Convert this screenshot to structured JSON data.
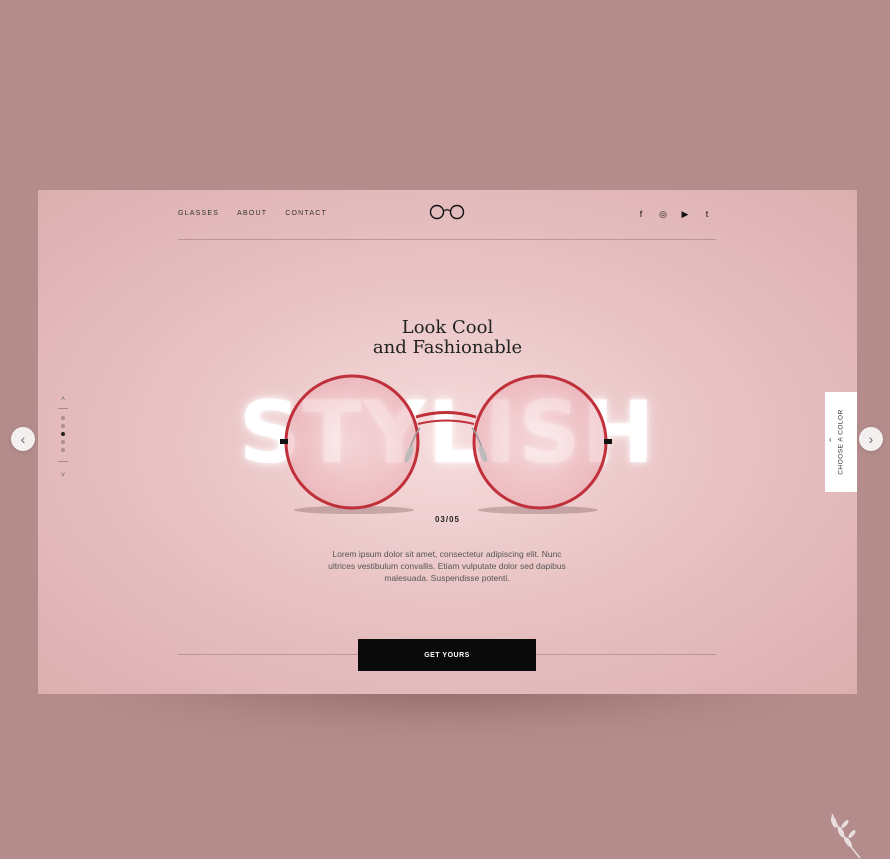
{
  "nav": {
    "items": [
      {
        "label": "GLASSES"
      },
      {
        "label": "ABOUT"
      },
      {
        "label": "CONTACT"
      }
    ]
  },
  "logo": {
    "icon": "glasses-logo-icon"
  },
  "socials": [
    {
      "icon": "facebook-icon",
      "glyph": "f"
    },
    {
      "icon": "instagram-icon",
      "glyph": "◎"
    },
    {
      "icon": "youtube-icon",
      "glyph": "▶"
    },
    {
      "icon": "twitter-icon",
      "glyph": "t"
    }
  ],
  "hero": {
    "headline_line1": "Look Cool",
    "headline_line2": "and Fashionable",
    "big_word": "STYLISH",
    "counter": "03/05",
    "description": "Lorem ipsum dolor sit amet, consectetur adipiscing elit. Nunc ultrices vestibulum convallis. Etiam vulputate dolor sed dapibus malesuada. Suspendisse potenti.",
    "cta_label": "GET YOURS"
  },
  "pager": {
    "up_glyph": "˄",
    "down_glyph": "˅",
    "dot_count": 5,
    "active_index": 2
  },
  "color_tab": {
    "label": "CHOOSE A COLOR",
    "chevron": "‹"
  },
  "carousel": {
    "prev_glyph": "‹",
    "next_glyph": "›"
  },
  "colors": {
    "background": "#b38c8b",
    "card": "#e9c3c4",
    "frame": "#c0303a",
    "cta": "#0a0a0a"
  }
}
